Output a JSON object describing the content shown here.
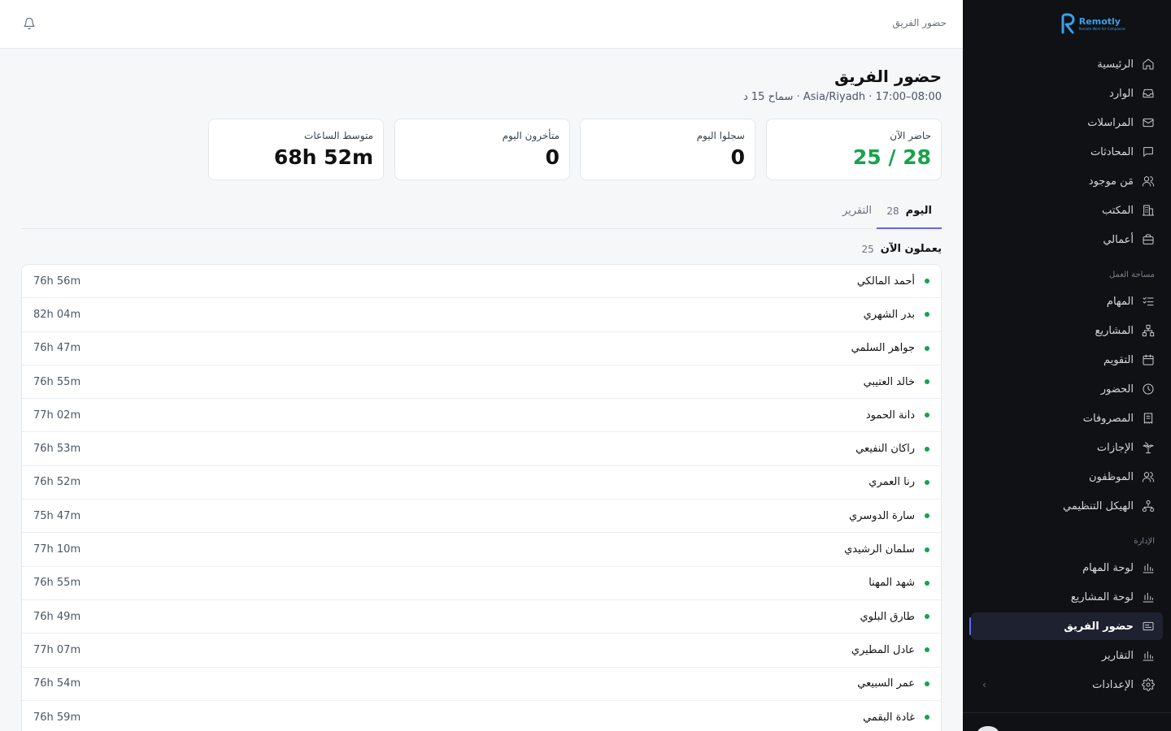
{
  "brand": {
    "name": "Remotly",
    "tagline": "Remote Work for Companies"
  },
  "header": {
    "breadcrumb": "حضور الفريق"
  },
  "page": {
    "title": "حضور الفريق",
    "subtitle": "08:00–17:00 · Asia/Riyadh · سماح 15 د"
  },
  "stats": [
    {
      "label": "حاضر الآن",
      "value": "25 / 28",
      "accent": "#16a34a"
    },
    {
      "label": "سجلوا اليوم",
      "value": "0"
    },
    {
      "label": "متأخرون اليوم",
      "value": "0"
    },
    {
      "label": "متوسط الساعات",
      "value": "68h 52m"
    }
  ],
  "tabs": [
    {
      "label": "اليوم",
      "count": "28",
      "active": true
    },
    {
      "label": "التقرير"
    }
  ],
  "group": {
    "title": "يعملون الآن",
    "count": "25"
  },
  "rows": [
    {
      "name": "أحمد المالكي",
      "hours": "76h 56m"
    },
    {
      "name": "بدر الشهري",
      "hours": "82h 04m"
    },
    {
      "name": "جواهر السلمي",
      "hours": "76h 47m"
    },
    {
      "name": "خالد العتيبي",
      "hours": "76h 55m"
    },
    {
      "name": "دانة الحمود",
      "hours": "77h 02m"
    },
    {
      "name": "راكان النفيعي",
      "hours": "76h 53m"
    },
    {
      "name": "رنا العمري",
      "hours": "76h 52m"
    },
    {
      "name": "سارة الدوسري",
      "hours": "75h 47m"
    },
    {
      "name": "سلمان الرشيدي",
      "hours": "77h 10m"
    },
    {
      "name": "شهد المهنا",
      "hours": "76h 55m"
    },
    {
      "name": "طارق البلوي",
      "hours": "76h 49m"
    },
    {
      "name": "عادل المطيري",
      "hours": "77h 07m"
    },
    {
      "name": "عمر السبيعي",
      "hours": "76h 54m"
    },
    {
      "name": "غادة البقمي",
      "hours": "76h 59m"
    }
  ],
  "sidebar": {
    "items": [
      {
        "label": "الرئيسية",
        "icon": "home-icon"
      },
      {
        "label": "الوارد",
        "icon": "inbox-icon"
      },
      {
        "label": "المراسلات",
        "icon": "mail-icon"
      },
      {
        "label": "المحادثات",
        "icon": "chat-icon"
      },
      {
        "label": "مَن موجود",
        "icon": "users-icon"
      },
      {
        "label": "المكتب",
        "icon": "building-icon"
      },
      {
        "label": "أعمالي",
        "icon": "briefcase-icon"
      }
    ],
    "workspace_label": "مساحة العمل",
    "workspace_items": [
      {
        "label": "المهام",
        "icon": "tasks-icon"
      },
      {
        "label": "المشاريع",
        "icon": "hierarchy-icon"
      },
      {
        "label": "التقويم",
        "icon": "calendar-icon"
      },
      {
        "label": "الحضور",
        "icon": "clock-icon"
      },
      {
        "label": "المصروفات",
        "icon": "receipt-icon"
      },
      {
        "label": "الإجازات",
        "icon": "palm-icon"
      },
      {
        "label": "الموظفون",
        "icon": "users-icon"
      },
      {
        "label": "الهيكل التنظيمي",
        "icon": "org-chart-icon"
      }
    ],
    "admin_label": "الإدارة",
    "admin_items": [
      {
        "label": "لوحة المهام",
        "icon": "bar-chart-icon"
      },
      {
        "label": "لوحة المشاريع",
        "icon": "bar-chart-icon"
      },
      {
        "label": "حضور الفريق",
        "icon": "id-card-icon",
        "active": true
      },
      {
        "label": "التقارير",
        "icon": "bar-chart-icon"
      },
      {
        "label": "الإعدادات",
        "icon": "gear-icon"
      }
    ]
  }
}
